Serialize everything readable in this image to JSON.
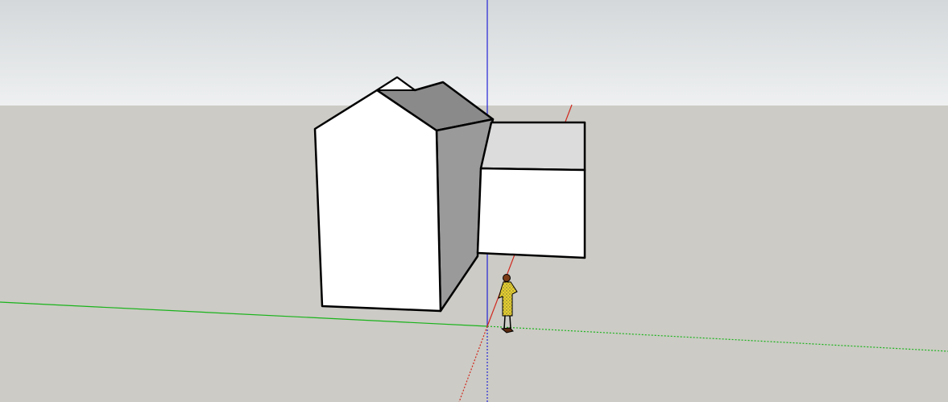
{
  "app": {
    "name": "",
    "view": "3d-model-viewport"
  },
  "scene": {
    "sky_colors": [
      "#d4d8da",
      "#eef0f1"
    ],
    "ground_color": "#cccbc5",
    "axes": {
      "red_axis_color": "#d0281e",
      "green_axis_color": "#19b31b",
      "blue_axis_color": "#2323d6"
    },
    "model": {
      "description_icon": "house-model-icon",
      "face_front": "#ffffff",
      "face_side": "#9a9a9a",
      "face_roof_dark": "#8a8a8a",
      "face_top_light": "#dcdcdc",
      "edge_color": "#000000"
    },
    "figure": {
      "icon": "scale-person-icon",
      "dress_color": "#e6d032"
    }
  }
}
